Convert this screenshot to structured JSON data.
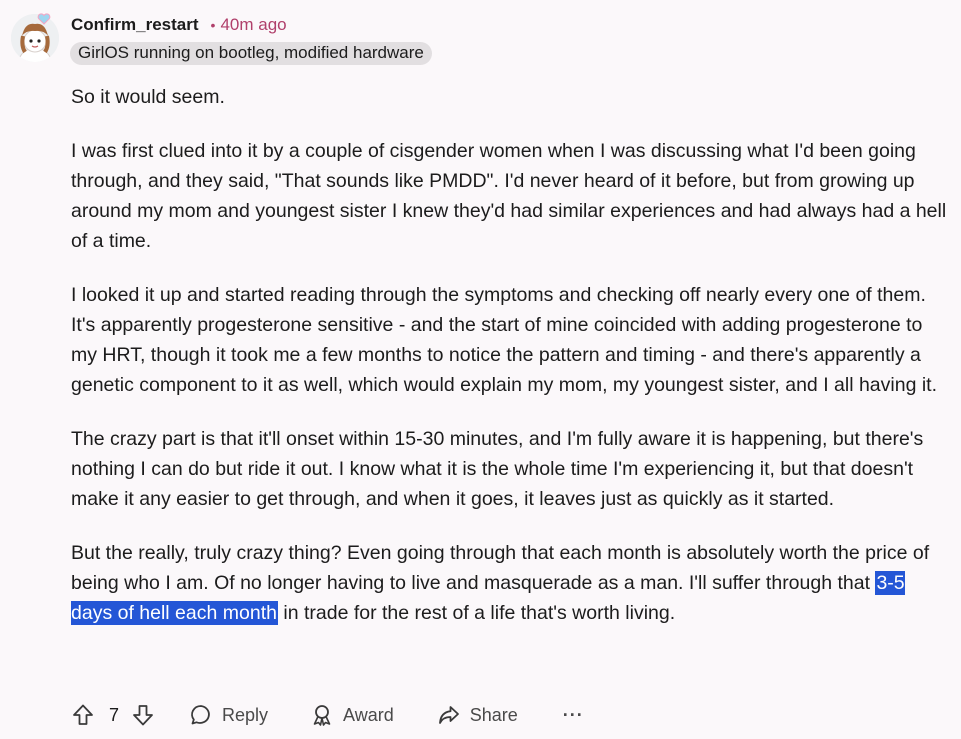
{
  "comment": {
    "username": "Confirm_restart",
    "separator": "•",
    "time": "40m ago",
    "flair": "GirlOS running on bootleg, modified hardware",
    "paragraphs": [
      "So it would seem.",
      "I was first clued into it by a couple of cisgender women when I was discussing what I'd been going through, and they said, \"That sounds like PMDD\". I'd never heard of it before, but from growing up around my mom and youngest sister I knew they'd had similar experiences and had always had a hell of a time.",
      "I looked it up and started reading through the symptoms and checking off nearly every one of them. It's apparently progesterone sensitive - and the start of mine coincided with adding progesterone to my HRT, though it took me a few months to notice the pattern and timing - and there's apparently a genetic component to it as well, which would explain my mom, my youngest sister, and I all having it.",
      "The crazy part is that it'll onset within 15-30 minutes, and I'm fully aware it is happening, but there's nothing I can do but ride it out. I know what it is the whole time I'm experiencing it, but that doesn't make it any easier to get through, and when it goes, it leaves just as quickly as it started."
    ],
    "last_paragraph": {
      "before": "But the really, truly crazy thing? Even going through that each month is absolutely worth the price of being who I am. Of no longer having to live and masquerade as a man. I'll suffer through that ",
      "highlighted": "3-5 days of hell each month",
      "after": " in trade for the rest of a life that's worth living."
    }
  },
  "actions": {
    "score": "7",
    "reply": "Reply",
    "award": "Award",
    "share": "Share",
    "more": "···"
  },
  "icons": {
    "upvote": "arrow-up-icon",
    "downvote": "arrow-down-icon",
    "reply": "speech-bubble-icon",
    "award": "award-ribbon-icon",
    "share": "share-arrow-icon",
    "more": "ellipsis-icon"
  },
  "colors": {
    "background": "#fbf8fa",
    "meta": "#b0406b",
    "highlight": "#2456d6",
    "flair_bg": "#e2dfe1"
  }
}
